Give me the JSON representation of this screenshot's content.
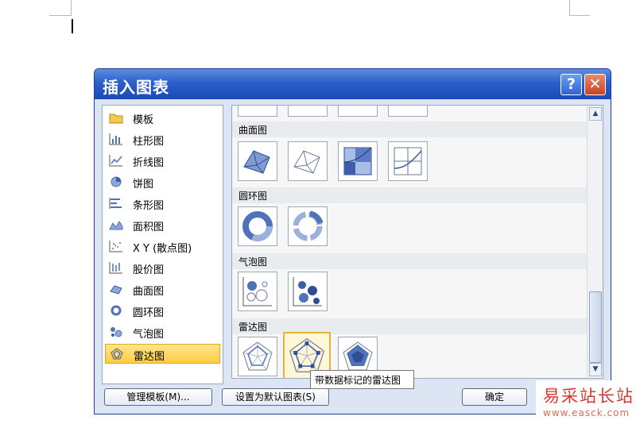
{
  "dialog": {
    "title": "插入图表",
    "help_label": "?",
    "close_label": "✕"
  },
  "categories": [
    {
      "label": "模板",
      "icon": "folder-icon"
    },
    {
      "label": "柱形图",
      "icon": "column-chart-icon"
    },
    {
      "label": "折线图",
      "icon": "line-chart-icon"
    },
    {
      "label": "饼图",
      "icon": "pie-chart-icon"
    },
    {
      "label": "条形图",
      "icon": "bar-chart-icon"
    },
    {
      "label": "面积图",
      "icon": "area-chart-icon"
    },
    {
      "label": "X Y (散点图)",
      "icon": "scatter-chart-icon"
    },
    {
      "label": "股价图",
      "icon": "stock-chart-icon"
    },
    {
      "label": "曲面图",
      "icon": "surface-chart-icon"
    },
    {
      "label": "圆环图",
      "icon": "doughnut-chart-icon"
    },
    {
      "label": "气泡图",
      "icon": "bubble-chart-icon"
    },
    {
      "label": "雷达图",
      "icon": "radar-chart-icon",
      "selected": true
    }
  ],
  "sections": {
    "surface": "曲面图",
    "doughnut": "圆环图",
    "bubble": "气泡图",
    "radar": "雷达图"
  },
  "tooltip": "带数据标记的雷达图",
  "buttons": {
    "manage_templates": "管理模板(M)...",
    "set_default": "设置为默认图表(S)",
    "ok": "确定"
  },
  "watermark": {
    "name": "易采站长站",
    "url": "www.easck.com"
  },
  "colors": {
    "titlebar": "#2a5fc9",
    "selection": "#ffcb45",
    "chart_blue": "#4f72b8"
  }
}
